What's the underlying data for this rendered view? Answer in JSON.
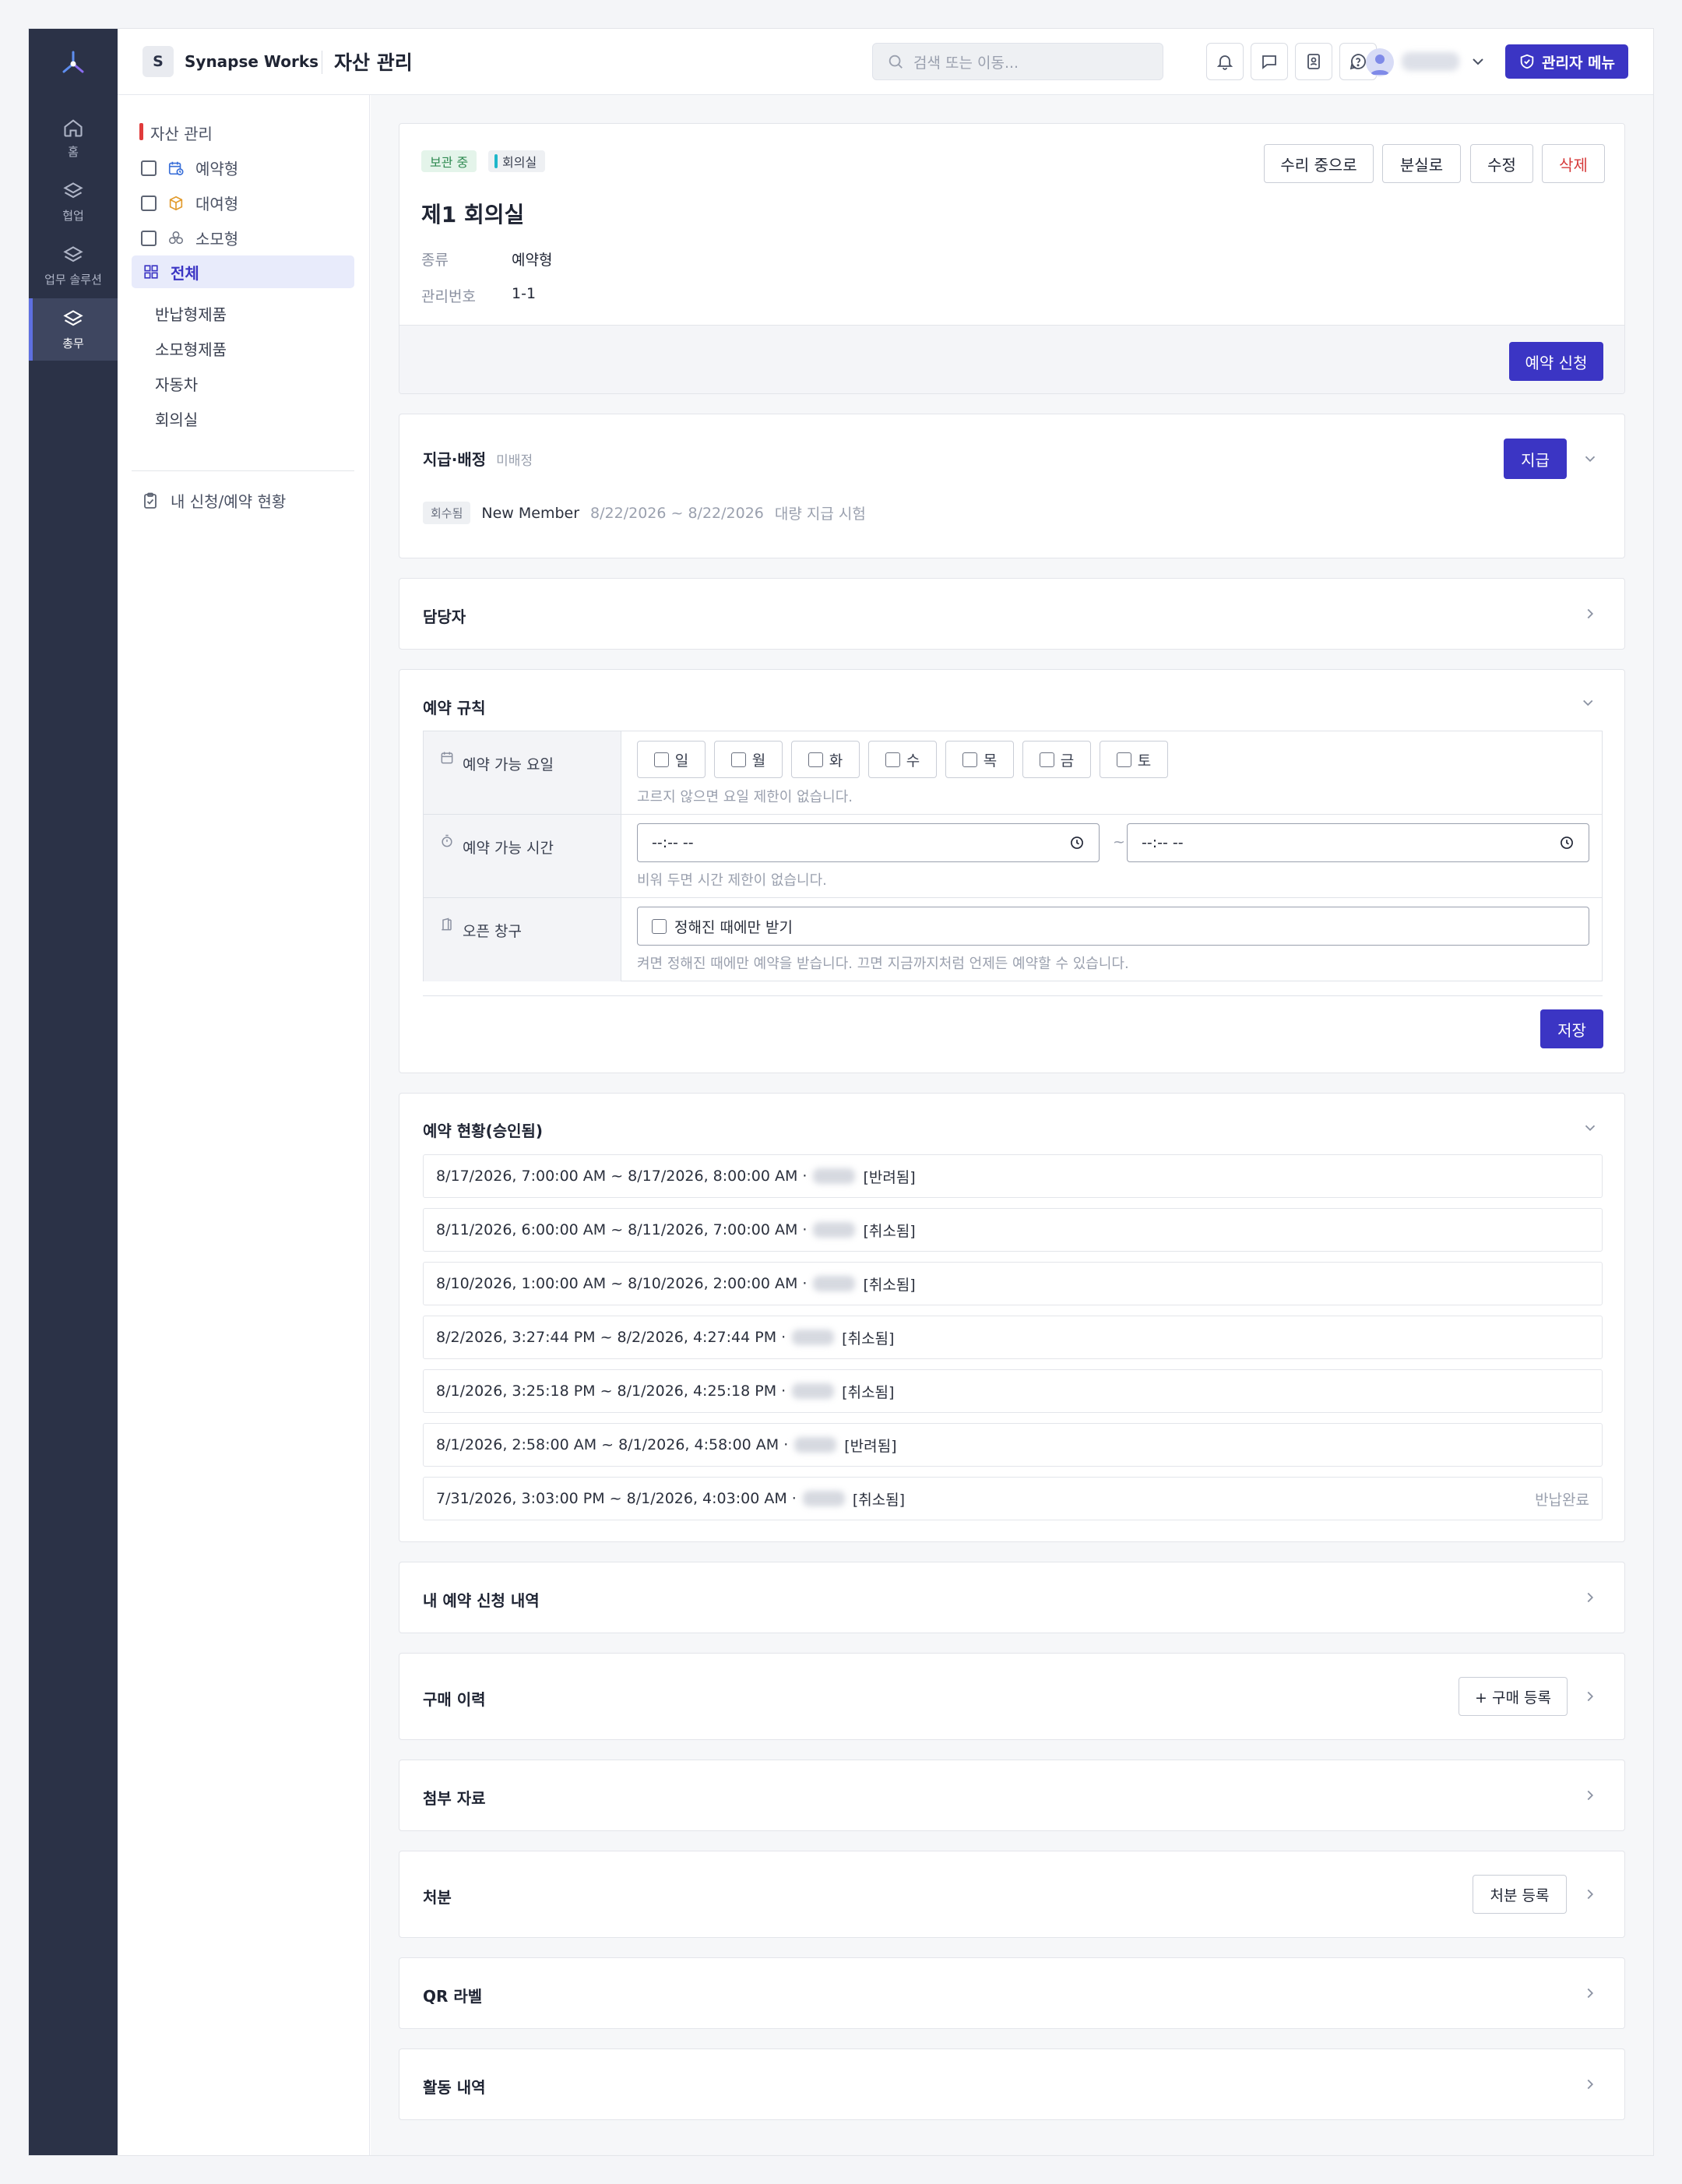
{
  "colors": {
    "rail": "#2b3247",
    "primary": "#3b35c4",
    "danger": "#d63a3a",
    "accent_red": "#e03b3b",
    "teal": "#1fb6c9"
  },
  "rail": {
    "items": [
      {
        "label": "홈",
        "icon": "home-icon"
      },
      {
        "label": "협업",
        "icon": "layers-icon"
      },
      {
        "label": "업무 솔루션",
        "icon": "layers-icon"
      },
      {
        "label": "총무",
        "icon": "layers-icon",
        "active": true
      }
    ]
  },
  "topbar": {
    "org_initial": "S",
    "org_name": "Synapse Works",
    "page_title": "자산 관리",
    "search_placeholder": "검색 또는 이동...",
    "admin_label": "관리자 메뉴"
  },
  "sidenav": {
    "header": "자산 관리",
    "types": [
      "예약형",
      "대여형",
      "소모형"
    ],
    "all_label": "전체",
    "categories": [
      "반납형제품",
      "소모형제품",
      "자동차",
      "회의실"
    ],
    "my_requests": "내 신청/예약 현황"
  },
  "asset": {
    "status_tag": "보관 중",
    "category_tag": "회의실",
    "actions": [
      "수리 중으로",
      "분실로",
      "수정",
      "삭제"
    ],
    "name": "제1 회의실",
    "fields": [
      {
        "label": "종류",
        "value": "예약형"
      },
      {
        "label": "관리번호",
        "value": "1-1"
      }
    ],
    "reserve_button": "예약 신청"
  },
  "supply": {
    "title": "지급·배정",
    "subtitle": "미배정",
    "button": "지급",
    "entry": {
      "badge": "회수됨",
      "member": "New Member",
      "range": "8/22/2026 ~ 8/22/2026",
      "note": "대량 지급 시험"
    }
  },
  "manager": {
    "title": "담당자"
  },
  "rules": {
    "title": "예약 규칙",
    "days_label": "예약 가능 요일",
    "days": [
      "일",
      "월",
      "화",
      "수",
      "목",
      "금",
      "토"
    ],
    "days_hint": "고르지 않으면 요일 제한이 없습니다.",
    "time_label": "예약 가능 시간",
    "time_placeholder": "--:-- --",
    "time_sep": "~",
    "time_hint": "비워 두면 시간 제한이 없습니다.",
    "window_label": "오픈 창구",
    "window_option": "정해진 때에만 받기",
    "window_hint": "켜면 정해진 때에만 예약을 받습니다. 끄면 지금까지처럼 언제든 예약할 수 있습니다.",
    "save": "저장"
  },
  "bookings": {
    "title": "예약 현황(승인됨)",
    "rows": [
      {
        "range": "8/17/2026, 7:00:00 AM ~ 8/17/2026, 8:00:00 AM ·",
        "state": "[반려됨]",
        "status": ""
      },
      {
        "range": "8/11/2026, 6:00:00 AM ~ 8/11/2026, 7:00:00 AM ·",
        "state": "[취소됨]",
        "status": ""
      },
      {
        "range": "8/10/2026, 1:00:00 AM ~ 8/10/2026, 2:00:00 AM ·",
        "state": "[취소됨]",
        "status": ""
      },
      {
        "range": "8/2/2026, 3:27:44 PM ~ 8/2/2026, 4:27:44 PM ·",
        "state": "[취소됨]",
        "status": ""
      },
      {
        "range": "8/1/2026, 3:25:18 PM ~ 8/1/2026, 4:25:18 PM ·",
        "state": "[취소됨]",
        "status": ""
      },
      {
        "range": "8/1/2026, 2:58:00 AM ~ 8/1/2026, 4:58:00 AM ·",
        "state": "[반려됨]",
        "status": ""
      },
      {
        "range": "7/31/2026, 3:03:00 PM ~ 8/1/2026, 4:03:00 AM ·",
        "state": "[취소됨]",
        "status": "반납완료"
      }
    ]
  },
  "sections": {
    "my_requests": "내 예약 신청 내역",
    "purchase": "구매 이력",
    "purchase_btn": "+ 구매 등록",
    "attachments": "첨부 자료",
    "disposal": "처분",
    "disposal_btn": "처분 등록",
    "qr": "QR 라벨",
    "activity": "활동 내역"
  }
}
